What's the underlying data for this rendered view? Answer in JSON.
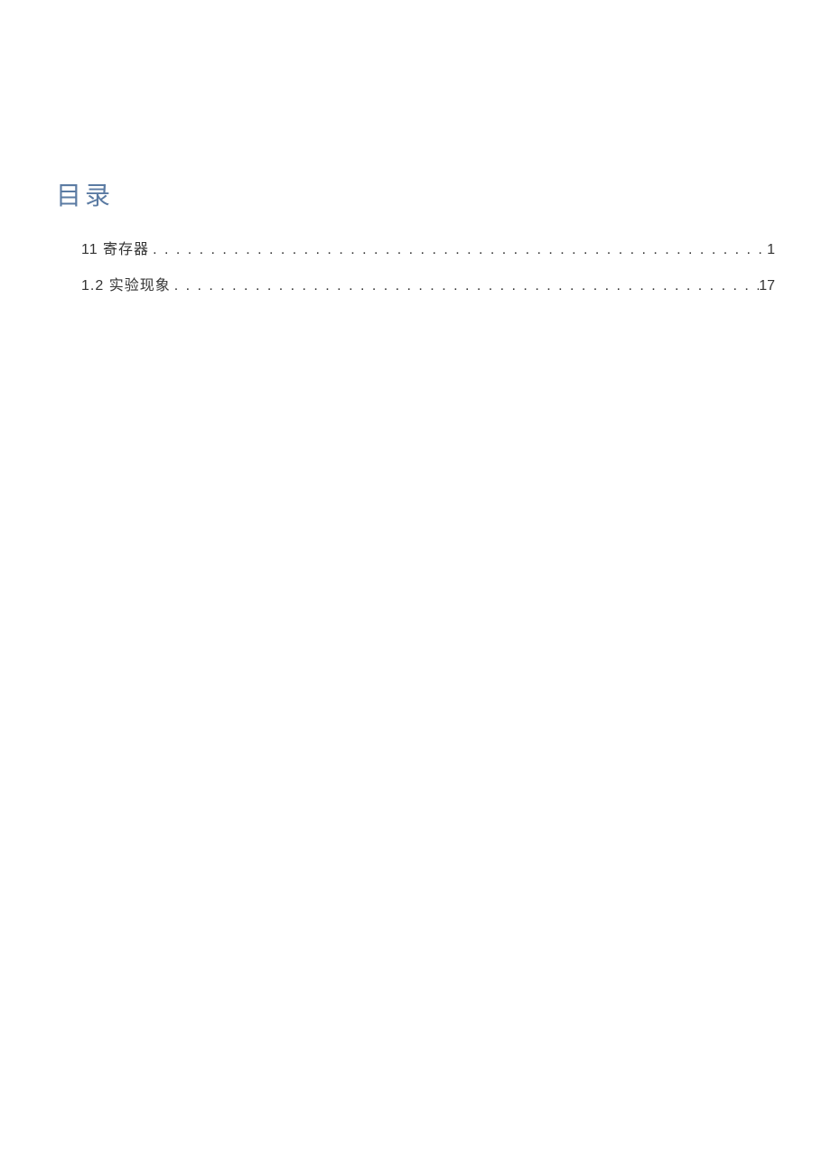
{
  "toc": {
    "title": "目录",
    "entries": [
      {
        "label": "11 寄存器",
        "page": "1"
      },
      {
        "label": "1.2 实验现象",
        "page": "17"
      }
    ]
  }
}
